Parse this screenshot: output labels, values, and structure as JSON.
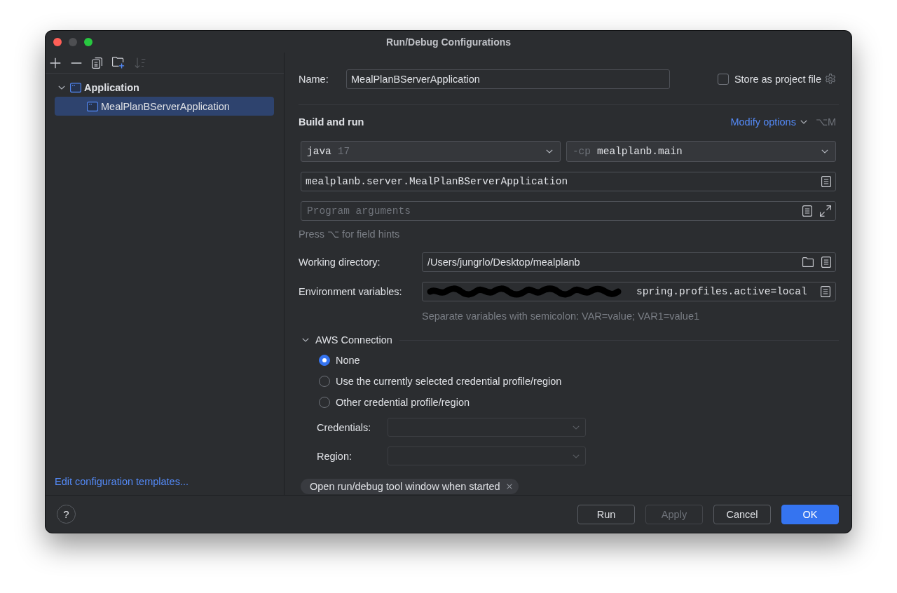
{
  "window": {
    "title": "Run/Debug Configurations",
    "controls": [
      {
        "kind": "close",
        "disabled": false
      },
      {
        "kind": "minimize",
        "disabled": true
      },
      {
        "kind": "zoom",
        "disabled": false
      }
    ]
  },
  "sidebar": {
    "toolbar": [
      {
        "kind": "add",
        "disabled": false
      },
      {
        "kind": "remove",
        "disabled": false
      },
      {
        "kind": "copy",
        "disabled": false
      },
      {
        "kind": "new-folder",
        "disabled": false
      },
      {
        "kind": "sort",
        "disabled": true
      }
    ],
    "tree": [
      {
        "label": "Application",
        "expanded": true,
        "selected": false,
        "children": [
          {
            "label": "MealPlanBServerApplication",
            "selected": true
          }
        ]
      }
    ],
    "templates_link": "Edit configuration templates..."
  },
  "name_row": {
    "label": "Name:",
    "value": "MealPlanBServerApplication",
    "store_as_project_file": {
      "label": "Store as project file",
      "checked": false
    }
  },
  "build_and_run": {
    "title": "Build and run",
    "modify_options": "Modify options",
    "shortcut": "⌥M",
    "jdk": {
      "keyword": "java",
      "version": "17"
    },
    "classpath": {
      "flag": "-cp",
      "module": "mealplanb.main"
    },
    "main_class": "mealplanb.server.MealPlanBServerApplication",
    "program_arguments": {
      "placeholder": "Program arguments"
    },
    "hint": "Press ⌥ for field hints"
  },
  "working_directory": {
    "label": "Working directory:",
    "value": "/Users/jungrlo/Desktop/mealplanb"
  },
  "environment_variables": {
    "label": "Environment variables:",
    "redacted": true,
    "value": "spring.profiles.active=local",
    "hint": "Separate variables with semicolon: VAR=value; VAR1=value1"
  },
  "aws_connection": {
    "title": "AWS Connection",
    "expanded": true,
    "options": [
      {
        "label": "None",
        "selected": true
      },
      {
        "label": "Use the currently selected credential profile/region",
        "selected": false
      },
      {
        "label": "Other credential profile/region",
        "selected": false
      }
    ],
    "credentials": {
      "label": "Credentials:",
      "disabled": true
    },
    "region": {
      "label": "Region:",
      "disabled": true
    }
  },
  "option_chips": [
    {
      "label": "Open run/debug tool window when started"
    }
  ],
  "footer": {
    "help": "?",
    "buttons": [
      {
        "label": "Run",
        "kind": "default",
        "disabled": false
      },
      {
        "label": "Apply",
        "kind": "default",
        "disabled": true
      },
      {
        "label": "Cancel",
        "kind": "default",
        "disabled": false
      },
      {
        "label": "OK",
        "kind": "primary",
        "disabled": false
      }
    ]
  }
}
